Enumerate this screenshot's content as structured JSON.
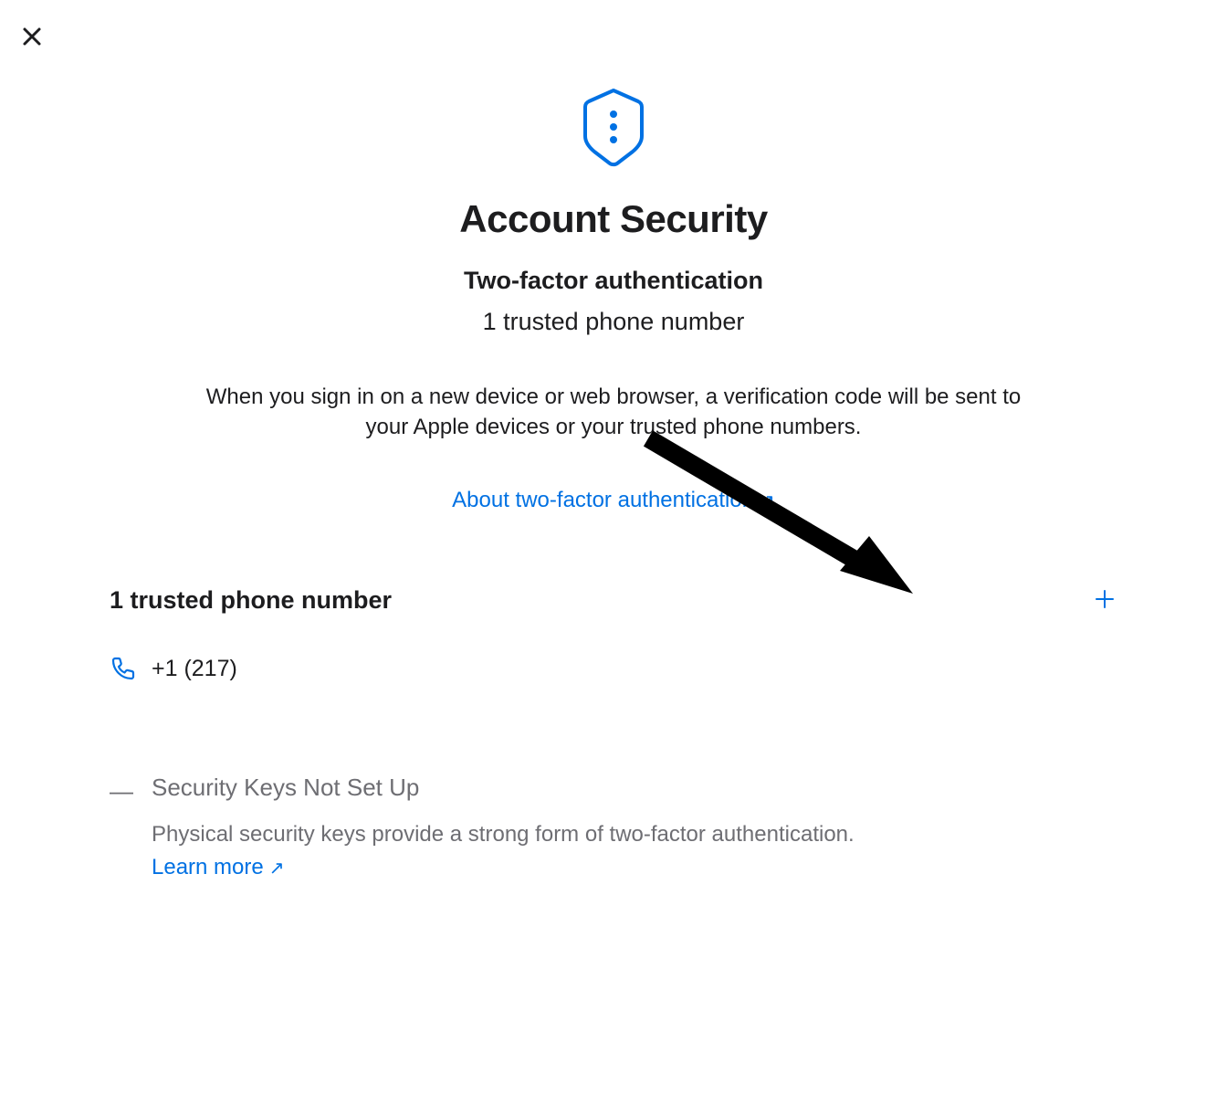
{
  "header": {
    "title": "Account Security",
    "subtitle": "Two-factor authentication",
    "count_text": "1 trusted phone number",
    "description": "When you sign in on a new device or web browser, a verification code will be sent to your Apple devices or your trusted phone numbers.",
    "about_link_label": "About two-factor authentication"
  },
  "trusted_numbers": {
    "section_title": "1 trusted phone number",
    "phone_number": "+1 (217)"
  },
  "security_keys": {
    "title": "Security Keys Not Set Up",
    "description": "Physical security keys provide a strong form of two-factor authentication.",
    "learn_more_label": "Learn more"
  },
  "colors": {
    "accent": "#0071e3",
    "text_primary": "#1d1d1f",
    "text_secondary": "#6e6e73"
  }
}
